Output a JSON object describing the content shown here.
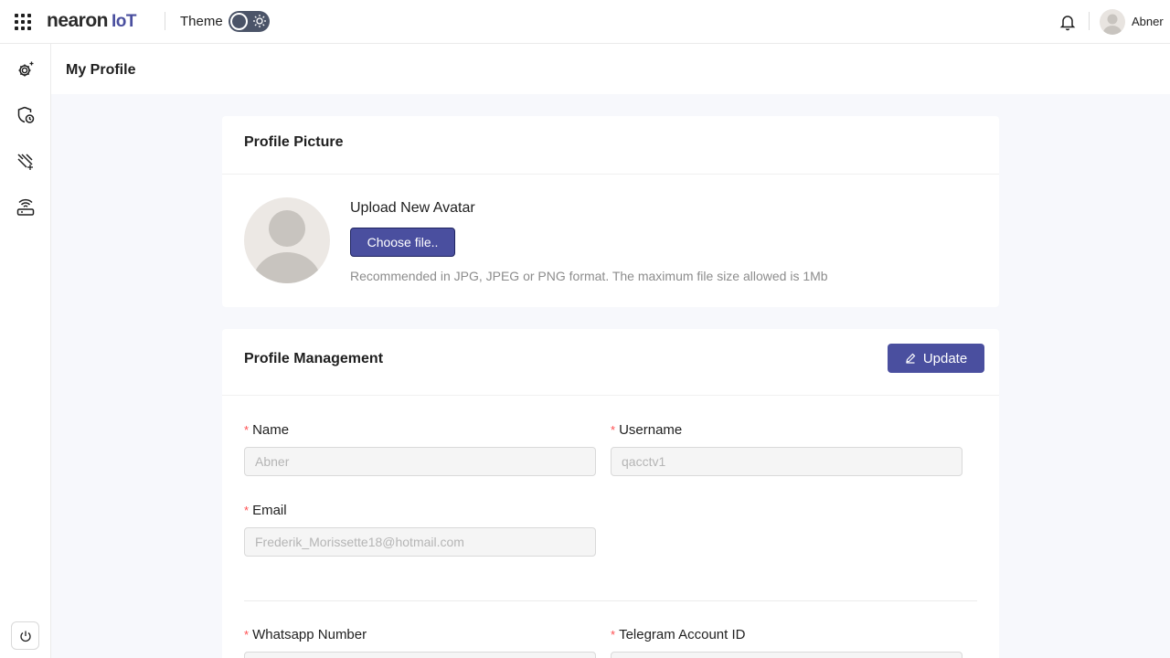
{
  "header": {
    "logo_main": "nearon",
    "logo_suffix": "IoT",
    "theme_label": "Theme",
    "user_name": "Abner"
  },
  "sidebar": {
    "items": [
      {
        "icon": "gear-sparkle-icon"
      },
      {
        "icon": "shield-clock-icon"
      },
      {
        "icon": "signal-lines-icon"
      },
      {
        "icon": "router-wifi-icon"
      }
    ],
    "footer_icon": "power-icon"
  },
  "page": {
    "title": "My Profile"
  },
  "profile_picture": {
    "title": "Profile Picture",
    "upload_title": "Upload New Avatar",
    "choose_label": "Choose file..",
    "hint": "Recommended in JPG, JPEG or PNG format. The maximum file size allowed is 1Mb"
  },
  "profile_management": {
    "title": "Profile Management",
    "update_label": "Update",
    "required_mark": "*",
    "fields": {
      "name": {
        "label": "Name",
        "value": "Abner"
      },
      "username": {
        "label": "Username",
        "value": "qacctv1"
      },
      "email": {
        "label": "Email",
        "value": "Frederik_Morissette18@hotmail.com"
      },
      "whatsapp": {
        "label": "Whatsapp Number",
        "value": ""
      },
      "telegram": {
        "label": "Telegram Account ID",
        "value": ""
      }
    }
  },
  "colors": {
    "accent": "#4a4f9f",
    "required": "#ff4d4f"
  }
}
